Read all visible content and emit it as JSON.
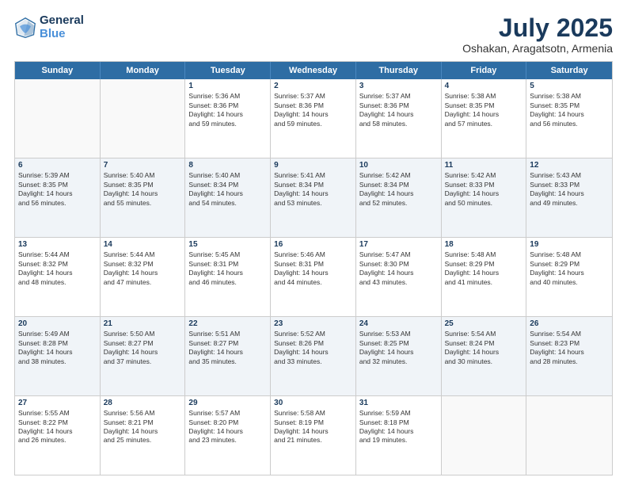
{
  "logo": {
    "line1": "General",
    "line2": "Blue"
  },
  "title": "July 2025",
  "subtitle": "Oshakan, Aragatsotn, Armenia",
  "weekdays": [
    "Sunday",
    "Monday",
    "Tuesday",
    "Wednesday",
    "Thursday",
    "Friday",
    "Saturday"
  ],
  "rows": [
    [
      {
        "day": "",
        "empty": true
      },
      {
        "day": "",
        "empty": true
      },
      {
        "day": "1",
        "l1": "Sunrise: 5:36 AM",
        "l2": "Sunset: 8:36 PM",
        "l3": "Daylight: 14 hours",
        "l4": "and 59 minutes."
      },
      {
        "day": "2",
        "l1": "Sunrise: 5:37 AM",
        "l2": "Sunset: 8:36 PM",
        "l3": "Daylight: 14 hours",
        "l4": "and 59 minutes."
      },
      {
        "day": "3",
        "l1": "Sunrise: 5:37 AM",
        "l2": "Sunset: 8:36 PM",
        "l3": "Daylight: 14 hours",
        "l4": "and 58 minutes."
      },
      {
        "day": "4",
        "l1": "Sunrise: 5:38 AM",
        "l2": "Sunset: 8:35 PM",
        "l3": "Daylight: 14 hours",
        "l4": "and 57 minutes."
      },
      {
        "day": "5",
        "l1": "Sunrise: 5:38 AM",
        "l2": "Sunset: 8:35 PM",
        "l3": "Daylight: 14 hours",
        "l4": "and 56 minutes."
      }
    ],
    [
      {
        "day": "6",
        "l1": "Sunrise: 5:39 AM",
        "l2": "Sunset: 8:35 PM",
        "l3": "Daylight: 14 hours",
        "l4": "and 56 minutes."
      },
      {
        "day": "7",
        "l1": "Sunrise: 5:40 AM",
        "l2": "Sunset: 8:35 PM",
        "l3": "Daylight: 14 hours",
        "l4": "and 55 minutes."
      },
      {
        "day": "8",
        "l1": "Sunrise: 5:40 AM",
        "l2": "Sunset: 8:34 PM",
        "l3": "Daylight: 14 hours",
        "l4": "and 54 minutes."
      },
      {
        "day": "9",
        "l1": "Sunrise: 5:41 AM",
        "l2": "Sunset: 8:34 PM",
        "l3": "Daylight: 14 hours",
        "l4": "and 53 minutes."
      },
      {
        "day": "10",
        "l1": "Sunrise: 5:42 AM",
        "l2": "Sunset: 8:34 PM",
        "l3": "Daylight: 14 hours",
        "l4": "and 52 minutes."
      },
      {
        "day": "11",
        "l1": "Sunrise: 5:42 AM",
        "l2": "Sunset: 8:33 PM",
        "l3": "Daylight: 14 hours",
        "l4": "and 50 minutes."
      },
      {
        "day": "12",
        "l1": "Sunrise: 5:43 AM",
        "l2": "Sunset: 8:33 PM",
        "l3": "Daylight: 14 hours",
        "l4": "and 49 minutes."
      }
    ],
    [
      {
        "day": "13",
        "l1": "Sunrise: 5:44 AM",
        "l2": "Sunset: 8:32 PM",
        "l3": "Daylight: 14 hours",
        "l4": "and 48 minutes."
      },
      {
        "day": "14",
        "l1": "Sunrise: 5:44 AM",
        "l2": "Sunset: 8:32 PM",
        "l3": "Daylight: 14 hours",
        "l4": "and 47 minutes."
      },
      {
        "day": "15",
        "l1": "Sunrise: 5:45 AM",
        "l2": "Sunset: 8:31 PM",
        "l3": "Daylight: 14 hours",
        "l4": "and 46 minutes."
      },
      {
        "day": "16",
        "l1": "Sunrise: 5:46 AM",
        "l2": "Sunset: 8:31 PM",
        "l3": "Daylight: 14 hours",
        "l4": "and 44 minutes."
      },
      {
        "day": "17",
        "l1": "Sunrise: 5:47 AM",
        "l2": "Sunset: 8:30 PM",
        "l3": "Daylight: 14 hours",
        "l4": "and 43 minutes."
      },
      {
        "day": "18",
        "l1": "Sunrise: 5:48 AM",
        "l2": "Sunset: 8:29 PM",
        "l3": "Daylight: 14 hours",
        "l4": "and 41 minutes."
      },
      {
        "day": "19",
        "l1": "Sunrise: 5:48 AM",
        "l2": "Sunset: 8:29 PM",
        "l3": "Daylight: 14 hours",
        "l4": "and 40 minutes."
      }
    ],
    [
      {
        "day": "20",
        "l1": "Sunrise: 5:49 AM",
        "l2": "Sunset: 8:28 PM",
        "l3": "Daylight: 14 hours",
        "l4": "and 38 minutes."
      },
      {
        "day": "21",
        "l1": "Sunrise: 5:50 AM",
        "l2": "Sunset: 8:27 PM",
        "l3": "Daylight: 14 hours",
        "l4": "and 37 minutes."
      },
      {
        "day": "22",
        "l1": "Sunrise: 5:51 AM",
        "l2": "Sunset: 8:27 PM",
        "l3": "Daylight: 14 hours",
        "l4": "and 35 minutes."
      },
      {
        "day": "23",
        "l1": "Sunrise: 5:52 AM",
        "l2": "Sunset: 8:26 PM",
        "l3": "Daylight: 14 hours",
        "l4": "and 33 minutes."
      },
      {
        "day": "24",
        "l1": "Sunrise: 5:53 AM",
        "l2": "Sunset: 8:25 PM",
        "l3": "Daylight: 14 hours",
        "l4": "and 32 minutes."
      },
      {
        "day": "25",
        "l1": "Sunrise: 5:54 AM",
        "l2": "Sunset: 8:24 PM",
        "l3": "Daylight: 14 hours",
        "l4": "and 30 minutes."
      },
      {
        "day": "26",
        "l1": "Sunrise: 5:54 AM",
        "l2": "Sunset: 8:23 PM",
        "l3": "Daylight: 14 hours",
        "l4": "and 28 minutes."
      }
    ],
    [
      {
        "day": "27",
        "l1": "Sunrise: 5:55 AM",
        "l2": "Sunset: 8:22 PM",
        "l3": "Daylight: 14 hours",
        "l4": "and 26 minutes."
      },
      {
        "day": "28",
        "l1": "Sunrise: 5:56 AM",
        "l2": "Sunset: 8:21 PM",
        "l3": "Daylight: 14 hours",
        "l4": "and 25 minutes."
      },
      {
        "day": "29",
        "l1": "Sunrise: 5:57 AM",
        "l2": "Sunset: 8:20 PM",
        "l3": "Daylight: 14 hours",
        "l4": "and 23 minutes."
      },
      {
        "day": "30",
        "l1": "Sunrise: 5:58 AM",
        "l2": "Sunset: 8:19 PM",
        "l3": "Daylight: 14 hours",
        "l4": "and 21 minutes."
      },
      {
        "day": "31",
        "l1": "Sunrise: 5:59 AM",
        "l2": "Sunset: 8:18 PM",
        "l3": "Daylight: 14 hours",
        "l4": "and 19 minutes."
      },
      {
        "day": "",
        "empty": true
      },
      {
        "day": "",
        "empty": true
      }
    ]
  ]
}
